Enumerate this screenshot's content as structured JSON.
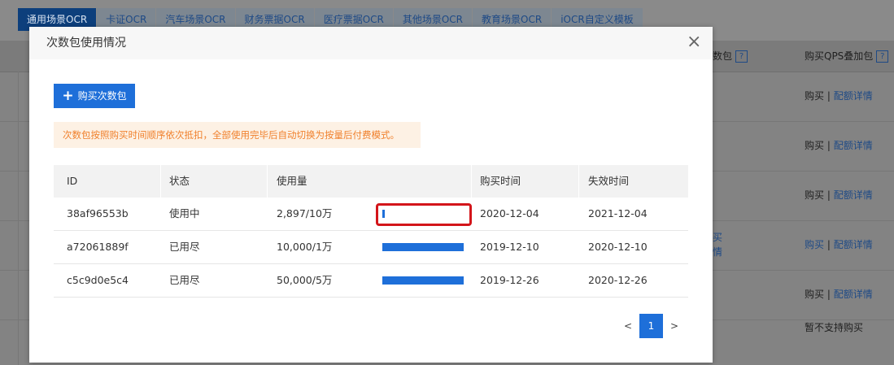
{
  "background": {
    "tabs": [
      {
        "label": "通用场景OCR",
        "active": true
      },
      {
        "label": "卡证OCR"
      },
      {
        "label": "汽车场景OCR"
      },
      {
        "label": "财务票据OCR"
      },
      {
        "label": "医疗票据OCR"
      },
      {
        "label": "其他场景OCR"
      },
      {
        "label": "教育场景OCR"
      },
      {
        "label": "iOCR自定义模板"
      }
    ],
    "header_partial": "数包",
    "header_help": "?",
    "header_qps": "购买QPS叠加包",
    "side_links": [
      "买",
      "情"
    ],
    "rows": [
      {
        "buy": "购买",
        "sep": "|",
        "detail": "配额详情"
      },
      {
        "buy": "购买",
        "sep": "|",
        "detail": "配额详情"
      },
      {
        "buy": "购买",
        "sep": "|",
        "detail": "配额详情"
      },
      {
        "buy": "购买",
        "sep": "|",
        "detail": "配额详情"
      },
      {
        "buy": "购买",
        "sep": "|",
        "detail": "配额详情"
      },
      {
        "text": "暂不支持购买"
      }
    ]
  },
  "modal": {
    "title": "次数包使用情况",
    "close_label": "×",
    "buy_button": {
      "icon": "plus-icon",
      "label": "购买次数包"
    },
    "notice": "次数包按照购买时间顺序依次抵扣，全部使用完毕后自动切换为按量后付费模式。",
    "table": {
      "headers": [
        "ID",
        "状态",
        "使用量",
        "购买时间",
        "失效时间"
      ],
      "rows": [
        {
          "id": "38af96553b",
          "status": "使用中",
          "usage": "2,897/10万",
          "fraction": 0.029,
          "purchase": "2020-12-04",
          "expire": "2021-12-04"
        },
        {
          "id": "a72061889f",
          "status": "已用尽",
          "usage": "10,000/1万",
          "fraction": 1.0,
          "purchase": "2019-12-10",
          "expire": "2020-12-10"
        },
        {
          "id": "c5c9d0e5c4",
          "status": "已用尽",
          "usage": "50,000/5万",
          "fraction": 1.0,
          "purchase": "2019-12-26",
          "expire": "2020-12-26"
        }
      ]
    },
    "pagination": {
      "prev": "<",
      "current": "1",
      "next": ">"
    }
  },
  "colors": {
    "primary": "#1e6fd9",
    "notice_bg": "#fdf1e4",
    "notice_text": "#f0802c",
    "highlight": "#d3151a"
  }
}
